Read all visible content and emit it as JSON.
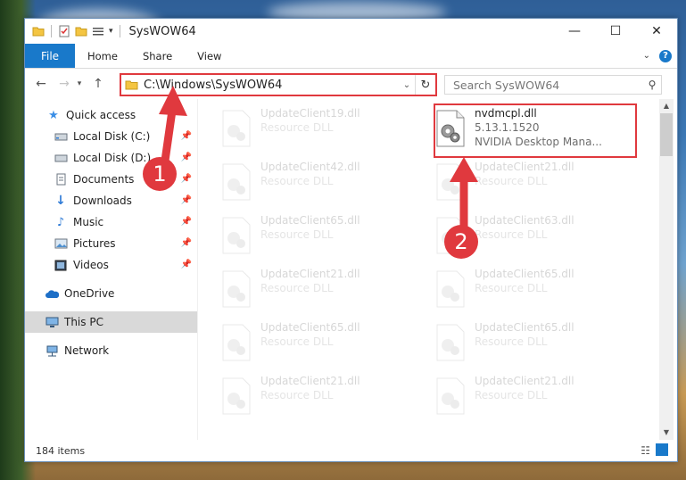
{
  "window": {
    "title": "SysWOW64"
  },
  "ribbon": {
    "tabs": [
      "File",
      "Home",
      "Share",
      "View"
    ]
  },
  "address": {
    "path": "C:\\Windows\\SysWOW64"
  },
  "search": {
    "placeholder": "Search SysWOW64"
  },
  "sidebar": {
    "items": [
      {
        "label": "Quick access",
        "icon": "star-icon"
      },
      {
        "label": "Local Disk (C:)",
        "icon": "drive-icon"
      },
      {
        "label": "Local Disk (D:)",
        "icon": "drive-icon"
      },
      {
        "label": "Documents",
        "icon": "documents-icon"
      },
      {
        "label": "Downloads",
        "icon": "download-icon"
      },
      {
        "label": "Music",
        "icon": "music-icon"
      },
      {
        "label": "Pictures",
        "icon": "pictures-icon"
      },
      {
        "label": "Videos",
        "icon": "videos-icon"
      },
      {
        "label": "OneDrive",
        "icon": "cloud-icon"
      },
      {
        "label": "This PC",
        "icon": "computer-icon"
      },
      {
        "label": "Network",
        "icon": "network-icon"
      }
    ]
  },
  "files": {
    "highlighted": {
      "name": "nvdmcpl.dll",
      "version": "5.13.1.1520",
      "description": "NVIDIA Desktop Mana..."
    },
    "left_column": [
      {
        "name": "UpdateClient19.dll",
        "type": "Resource DLL"
      },
      {
        "name": "UpdateClient42.dll",
        "type": "Resource DLL"
      },
      {
        "name": "UpdateClient65.dll",
        "type": "Resource DLL"
      },
      {
        "name": "UpdateClient21.dll",
        "type": "Resource DLL"
      },
      {
        "name": "UpdateClient65.dll",
        "type": "Resource DLL"
      },
      {
        "name": "UpdateClient21.dll",
        "type": "Resource DLL"
      }
    ],
    "right_column": [
      {
        "name": "UpdateClient21.dll",
        "type": "Resource DLL"
      },
      {
        "name": "UpdateClient63.dll",
        "type": "Resource DLL"
      },
      {
        "name": "UpdateClient65.dll",
        "type": "Resource DLL"
      },
      {
        "name": "UpdateClient65.dll",
        "type": "Resource DLL"
      },
      {
        "name": "UpdateClient21.dll",
        "type": "Resource DLL"
      }
    ]
  },
  "status": {
    "items": "184 items"
  },
  "annotations": {
    "badge1": "1",
    "badge2": "2"
  },
  "colors": {
    "accent": "#1979ca",
    "annotation": "#e0393e"
  }
}
